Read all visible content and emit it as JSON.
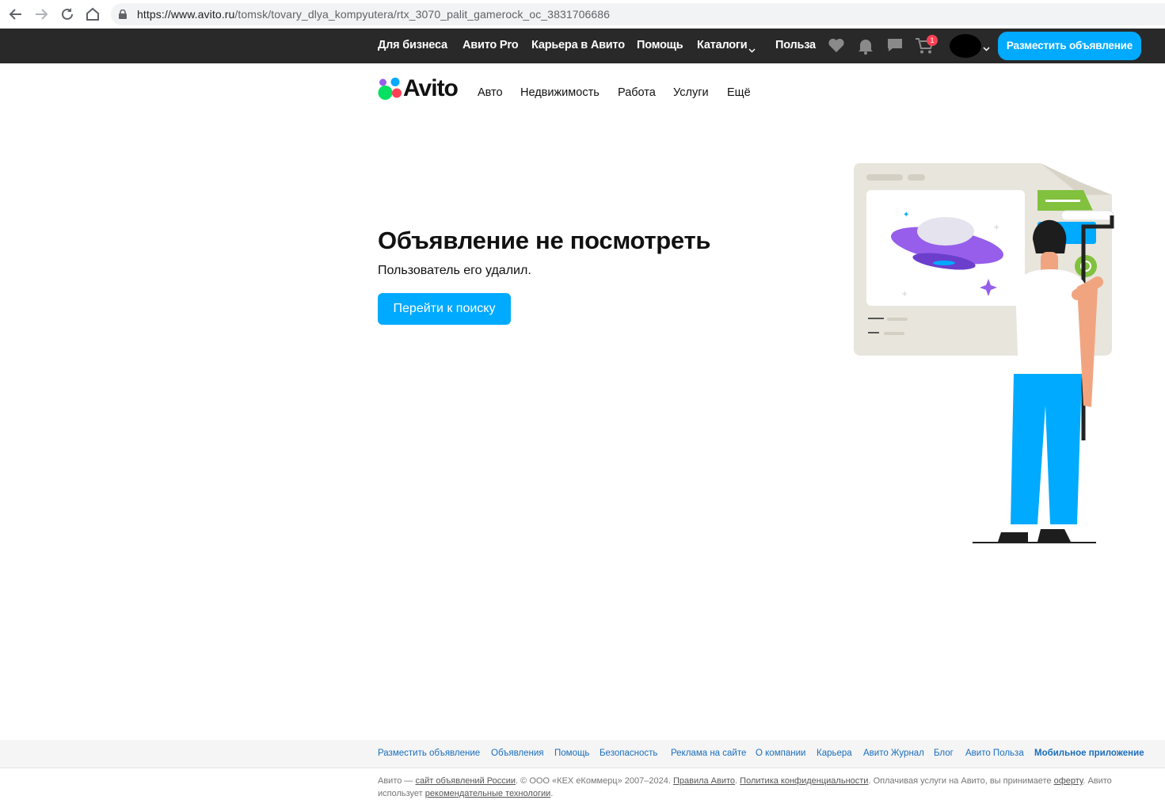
{
  "browser": {
    "url_host": "https://www.avito.ru",
    "url_path": "/tomsk/tovary_dlya_kompyutera/rtx_3070_palit_gamerock_oc_3831706686"
  },
  "topbar": {
    "links": [
      "Для бизнеса",
      "Авито Pro",
      "Карьера в Авито",
      "Помощь",
      "Каталоги",
      "Польза"
    ],
    "cart_count": "1",
    "post_button": "Разместить объявление"
  },
  "header": {
    "logo_text": "Avito",
    "categories": [
      "Авто",
      "Недвижимость",
      "Работа",
      "Услуги",
      "Ещё"
    ]
  },
  "main": {
    "title": "Объявление не посмотреть",
    "subtitle": "Пользователь его удалил.",
    "button": "Перейти к поиску"
  },
  "footer": {
    "links": [
      "Разместить объявление",
      "Объявления",
      "Помощь",
      "Безопасность",
      "Реклама на сайте",
      "О компании",
      "Карьера",
      "Авито Журнал",
      "Блог",
      "Авито Польза",
      "Мобильное приложение"
    ],
    "legal": {
      "p1": "Авито — ",
      "l1": "сайт объявлений России",
      "p2": ". © ООО «КЕХ eКоммерц» 2007–2024. ",
      "l2": "Правила Авито",
      "p3": ". ",
      "l3": "Политика конфиденциальности",
      "p4": ". Оплачивая услуги на Авито, вы принимаете ",
      "l4": "оферту",
      "p5": ". Авито использует ",
      "l5": "рекомендательные технологии",
      "p6": "."
    }
  },
  "colors": {
    "accent": "#00aaff",
    "topbar": "#292929",
    "badge": "#ff4053",
    "footer_link": "#1a6ebd"
  }
}
